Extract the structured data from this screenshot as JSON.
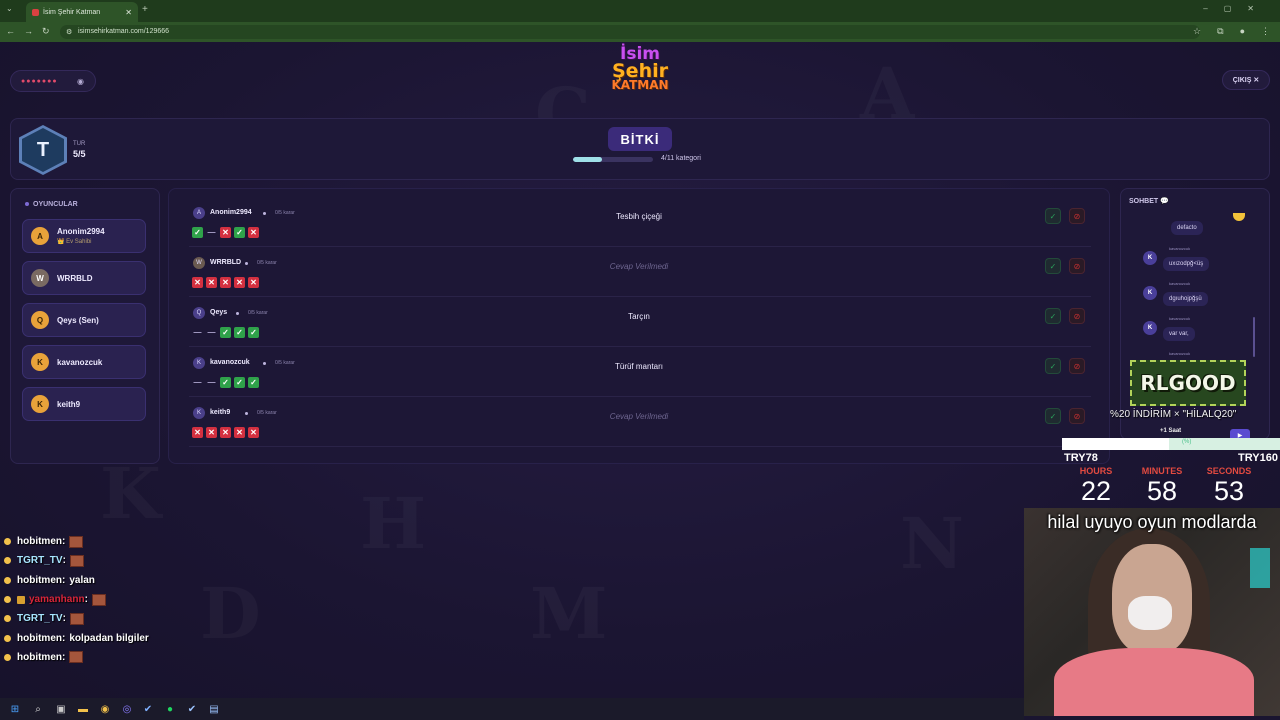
{
  "browser": {
    "tab_title": "İsim Şehir Katman",
    "url": "isimsehirkatman.com/129666"
  },
  "page": {
    "room_code_masked": "●●●●●●●",
    "logo": [
      "İsim",
      "Şehir",
      "KATMAN"
    ],
    "exit_label": "ÇIKIŞ ✕",
    "round_icon_letter": "T",
    "round_label": "TUR",
    "round_value": "5/5",
    "status": "BİTKİ",
    "progress_fraction": 0.36,
    "progress_text": "4/11 kategori"
  },
  "players": {
    "header": "OYUNCULAR",
    "items": [
      {
        "initial": "A",
        "name": "Anonim2994",
        "sub": "👑 Ev Sahibi"
      },
      {
        "initial": "W",
        "name": "WRRBLD",
        "sub": ""
      },
      {
        "initial": "Q",
        "name": "Qeys (Sen)",
        "sub": ""
      },
      {
        "initial": "K",
        "name": "kavanozcuk",
        "sub": ""
      },
      {
        "initial": "K",
        "name": "keith9",
        "sub": ""
      }
    ]
  },
  "answers": [
    {
      "initial": "A",
      "name": "Anonim2994",
      "votes": "0/5 karar",
      "answer": "Tesbih çiçeği",
      "given": true,
      "marks": [
        "ok",
        "nil",
        "no",
        "ok",
        "no"
      ]
    },
    {
      "initial": "W",
      "name": "WRRBLD",
      "votes": "0/5 karar",
      "answer": "Cevap Verilmedi",
      "given": false,
      "marks": [
        "no",
        "no",
        "no",
        "no",
        "no"
      ]
    },
    {
      "initial": "Q",
      "name": "Qeys",
      "votes": "0/5 karar",
      "answer": "Tarçın",
      "given": true,
      "marks": [
        "nil",
        "nil",
        "ok",
        "ok",
        "ok"
      ]
    },
    {
      "initial": "K",
      "name": "kavanozcuk",
      "votes": "0/5 karar",
      "answer": "Türüf mantarı",
      "given": true,
      "marks": [
        "nil",
        "nil",
        "ok",
        "ok",
        "ok"
      ]
    },
    {
      "initial": "K",
      "name": "keith9",
      "votes": "0/5 karar",
      "answer": "Cevap Verilmedi",
      "given": false,
      "marks": [
        "no",
        "no",
        "no",
        "no",
        "no"
      ]
    }
  ],
  "chat": {
    "header": "SOHBET 💬",
    "messages": [
      {
        "user": "",
        "text": "defacto"
      },
      {
        "user": "kavanozcuk",
        "text": "uxızodpğ<üş"
      },
      {
        "user": "kavanozcuk",
        "text": "dgıuhojpğşü"
      },
      {
        "user": "kavanozcuk",
        "text": "var var,"
      },
      {
        "user": "kavanozcuk",
        "text": ""
      }
    ]
  },
  "overlay": {
    "sponsor": "RLGOOD",
    "promo": "%20 İNDİRİM × \"HİLALQ20\"",
    "extra": "+1 Saat",
    "goal_percent": "(%)",
    "goal_fraction": 0.49,
    "try_current": "TRY78",
    "try_target": "TRY160",
    "timer": {
      "hours_label": "HOURS",
      "hours": "22",
      "minutes_label": "MINUTES",
      "minutes": "58",
      "seconds_label": "SECONDS",
      "seconds": "53"
    },
    "caption": "hilal uyuyo oyun modlarda"
  },
  "stream_chat": [
    {
      "user": "hobitmen",
      "color": "#ffffff",
      "message": "",
      "emote": true
    },
    {
      "user": "TGRT_TV",
      "color": "#a8e6ff",
      "message": "",
      "emote": true
    },
    {
      "user": "hobitmen",
      "color": "#ffffff",
      "message": "yalan",
      "emote": false
    },
    {
      "user": "yamanhann",
      "color": "#d8253a",
      "message": "",
      "emote": true
    },
    {
      "user": "TGRT_TV",
      "color": "#a8e6ff",
      "message": "",
      "emote": true
    },
    {
      "user": "hobitmen",
      "color": "#ffffff",
      "message": "kolpadan bilgiler",
      "emote": false
    },
    {
      "user": "hobitmen",
      "color": "#ffffff",
      "message": "",
      "emote": true
    }
  ],
  "colors": {
    "accent": "#3b2b7a",
    "approve": "#2fa24a",
    "reject": "#d33040",
    "player_avatar": "#e8a23a"
  }
}
